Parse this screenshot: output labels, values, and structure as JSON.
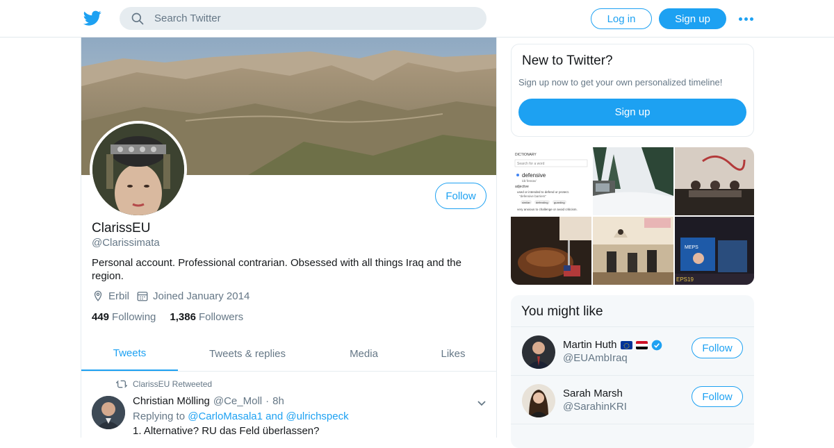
{
  "header": {
    "search_placeholder": "Search Twitter",
    "login_label": "Log in",
    "signup_label": "Sign up"
  },
  "profile": {
    "name": "ClarissEU",
    "handle": "@Clarissimata",
    "bio": "Personal account. Professional contrarian. Obsessed with all things Iraq and the region.",
    "location": "Erbil",
    "joined": "Joined January 2014",
    "following_count": "449",
    "following_label": "Following",
    "followers_count": "1,386",
    "followers_label": "Followers",
    "follow_label": "Follow"
  },
  "tabs": [
    {
      "label": "Tweets",
      "active": true
    },
    {
      "label": "Tweets & replies",
      "active": false
    },
    {
      "label": "Media",
      "active": false
    },
    {
      "label": "Likes",
      "active": false
    }
  ],
  "tweet": {
    "retweet_line": "ClarissEU Retweeted",
    "author": "Christian Mölling",
    "handle": "@Ce_Moll",
    "separator": "·",
    "time": "8h",
    "replying_prefix": "Replying to",
    "replying_to": "@CarloMasala1 and @ulrichspeck",
    "text": "1.  Alternative? RU das Feld überlassen?"
  },
  "new_to_twitter": {
    "title": "New to Twitter?",
    "subtitle": "Sign up now to get your own personalized timeline!",
    "button": "Sign up"
  },
  "media_preview": {
    "tile1_header": "DICTIONARY",
    "tile1_search": "Search for a word",
    "tile1_word": "defensive",
    "tile1_pron": "/dɪˈfensɪv/",
    "tile1_pos": "adjective",
    "tile1_def1": "used or intended to defend or protect.",
    "tile1_ex1": "\"defensive barriers\"",
    "tile1_chips": [
      "similar:",
      "defending",
      "guarding"
    ],
    "tile1_def2": "very anxious to challenge or avoid criticism.",
    "tile6_sign1": "MEPS",
    "tile6_sign2": "EPS19"
  },
  "you_might_like": {
    "title": "You might like",
    "items": [
      {
        "name": "Martin Huth",
        "handle": "@EUAmbIraq",
        "follow": "Follow",
        "verified": true
      },
      {
        "name": "Sarah Marsh",
        "handle": "@SarahinKRI",
        "follow": "Follow",
        "verified": false
      }
    ]
  },
  "colors": {
    "accent": "#1da1f2",
    "text": "#14171a",
    "muted": "#657786",
    "border": "#e6ecf0"
  }
}
